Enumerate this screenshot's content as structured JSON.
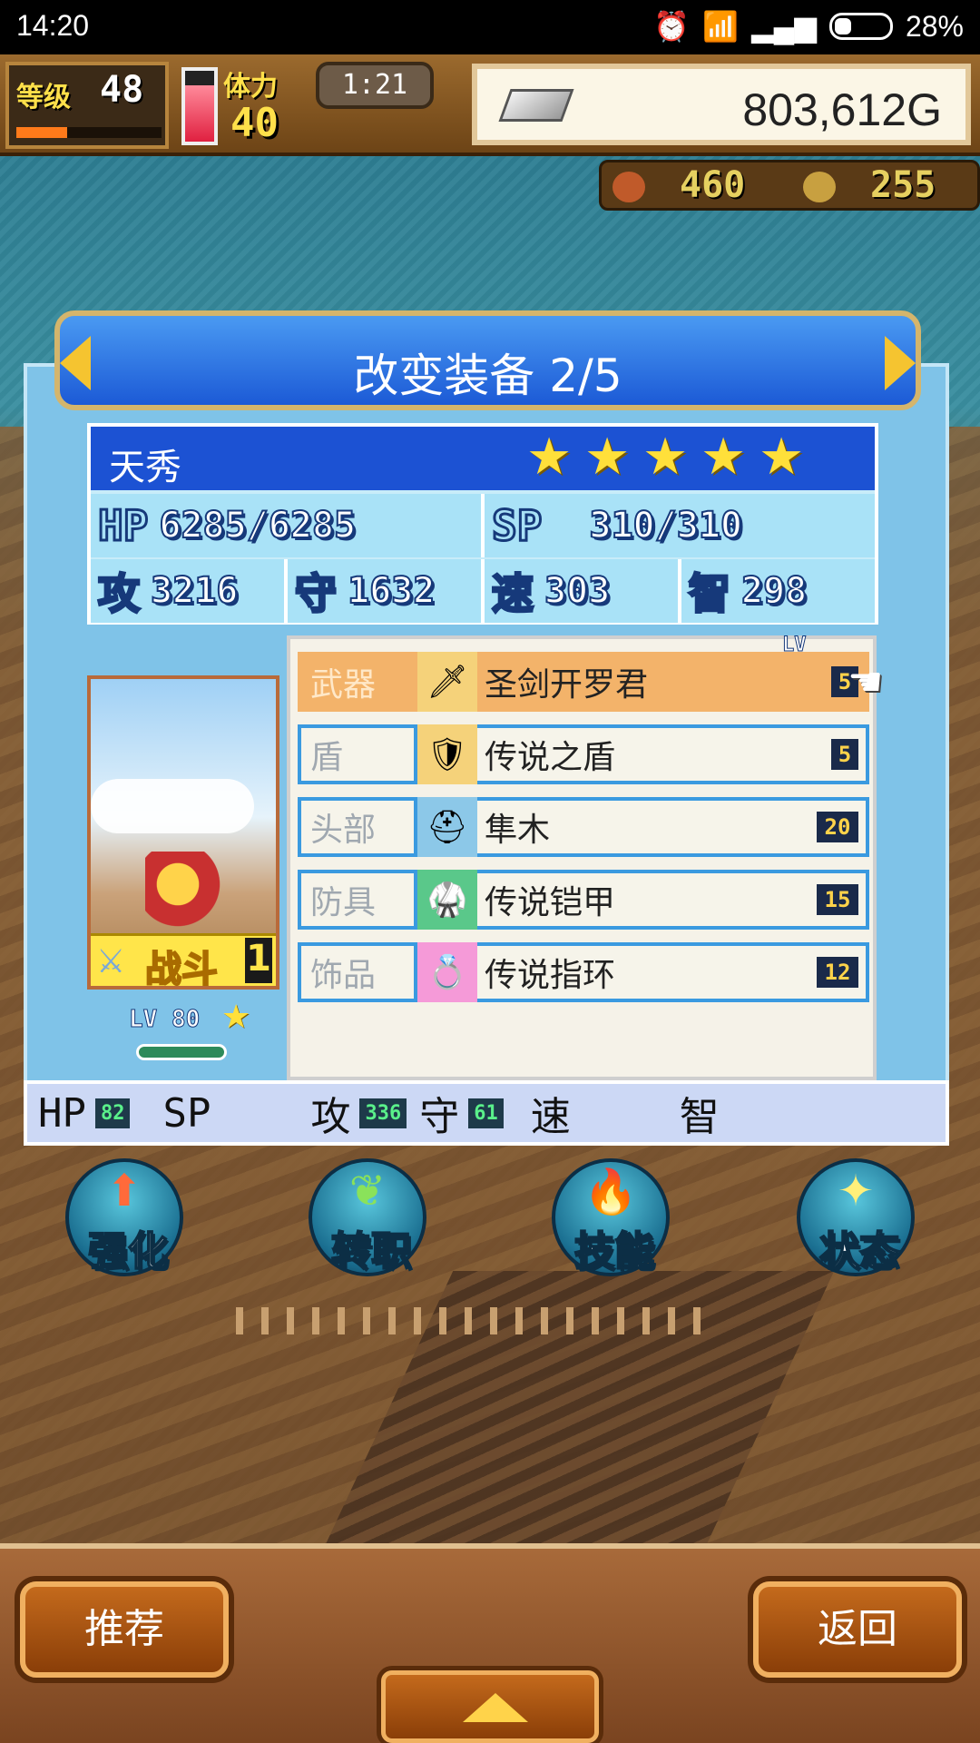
{
  "status_bar": {
    "time": "14:20",
    "battery": "28%"
  },
  "hud": {
    "level_label": "等级",
    "level": "48",
    "level_progress": 0.35,
    "stamina_label": "体力",
    "stamina": "40",
    "stamina_fill": 0.8,
    "timer": "1:21",
    "gold": "803,612G",
    "meat": "460",
    "coins": "255"
  },
  "panel": {
    "title": "改变装备 2/5",
    "character": {
      "name": "天秀",
      "stars": [
        "★",
        "★",
        "★",
        "★",
        "★"
      ],
      "hp_label": "HP",
      "hp": "6285/6285",
      "sp_label": "SP",
      "sp": "310/310",
      "atk_label": "攻",
      "atk": "3216",
      "def_label": "守",
      "def": "1632",
      "spd_label": "速",
      "spd": "303",
      "int_label": "智",
      "int": "298",
      "battle_label": "战斗",
      "battle_num": "1",
      "lv_text": "LV 80"
    },
    "lv_caption": "LV",
    "equipment": [
      {
        "slot": "武器",
        "name": "圣剑开罗君",
        "lv": "5",
        "icon": "sword-icon"
      },
      {
        "slot": "盾",
        "name": "传说之盾",
        "lv": "5",
        "icon": "shield-icon"
      },
      {
        "slot": "头部",
        "name": "隼木",
        "lv": "20",
        "icon": "helmet-icon"
      },
      {
        "slot": "防具",
        "name": "传说铠甲",
        "lv": "15",
        "icon": "armor-icon"
      },
      {
        "slot": "饰品",
        "name": "传说指环",
        "lv": "12",
        "icon": "ring-icon"
      }
    ],
    "diff": {
      "hp_label": "HP",
      "hp": "82",
      "sp_label": "SP",
      "atk_label": "攻",
      "atk": "336",
      "def_label": "守",
      "def": "61",
      "spd_label": "速",
      "int_label": "智"
    }
  },
  "actions": [
    {
      "label": "强化",
      "icon": "arrow-up-icon"
    },
    {
      "label": "转职",
      "icon": "leaf-icon"
    },
    {
      "label": "技能",
      "icon": "flame-icon"
    },
    {
      "label": "状态",
      "icon": "sparkle-icon"
    }
  ],
  "bottom": {
    "recommend": "推荐",
    "back": "返回"
  },
  "colors": {
    "panel": "#7fc3e8",
    "title": "#1c5ad6",
    "selected_row": "#f3b36a"
  }
}
